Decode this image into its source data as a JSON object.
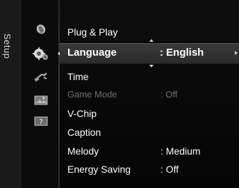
{
  "sidebar": {
    "label": "Setup"
  },
  "icons": [
    "picture-icon",
    "setup-icon",
    "input-icon",
    "application-icon",
    "support-icon"
  ],
  "menu": {
    "items": [
      {
        "label": "Plug & Play",
        "value": ""
      },
      {
        "label": "Language",
        "value": ": English"
      },
      {
        "label": "Time",
        "value": ""
      },
      {
        "label": "Game Mode",
        "value": ": Off"
      },
      {
        "label": "V-Chip",
        "value": ""
      },
      {
        "label": "Caption",
        "value": ""
      },
      {
        "label": "Melody",
        "value": ": Medium"
      },
      {
        "label": "Energy Saving",
        "value": ": Off"
      }
    ]
  },
  "support_icon_glyph": "?",
  "colors": {
    "text": "#ffffff",
    "disabled": "#707070",
    "highlight": "#3a3a3a",
    "background": "#050505"
  }
}
